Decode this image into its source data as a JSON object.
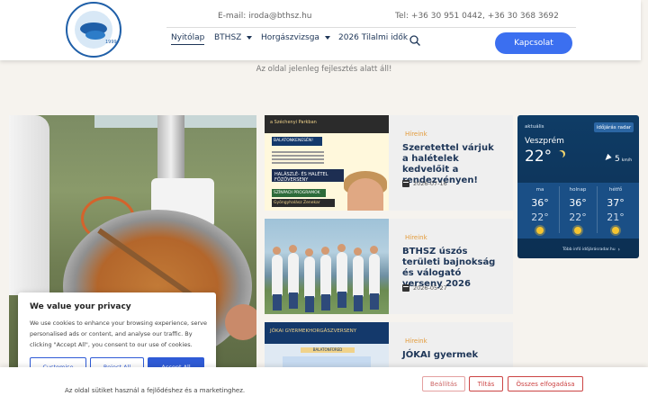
{
  "header": {
    "email": "E-mail: iroda@bthsz.hu",
    "phone": "Tel: +36 30 951 0442, +36 30 368 3692",
    "logo_year": "1999",
    "nav": [
      {
        "label": "Nyitólap"
      },
      {
        "label": "BTHSZ"
      },
      {
        "label": "Horgászvizsga"
      },
      {
        "label": "2026 Tilalmi idők"
      }
    ],
    "login_label": "Kapcsolat"
  },
  "notice": "Az oldal jelenleg fejlesztés alatt áll!",
  "news": [
    {
      "category": "Híreink",
      "title": "Szeretettel várjuk a halételek kedvelőit a rendezvényen!",
      "date": "2026-07-16",
      "thumb_text": {
        "band": "a Széchenyi Parkban",
        "tag": "BALATONKENESÉN!",
        "hal": "HALÁSZLÉ- ÉS HALÉTEL FŐZŐVERSENY",
        "prog": "SZÍNPADI PROGRAMOK",
        "prog2": "Gyöngyhalász Zenekar"
      }
    },
    {
      "category": "Híreink",
      "title": "BTHSZ úszós területi bajnokság és válogató verseny 2026",
      "date": "2026-05-27"
    },
    {
      "category": "Híreink",
      "title": "JÓKAI gyermek",
      "thumb_text": {
        "top": "JÓKAI GYERMEKHORGÁSZVERSENY",
        "sub": "BALATONFÜRED"
      }
    }
  ],
  "weather": {
    "label": "aktuális",
    "link": "időjárás radar",
    "city": "Veszprém",
    "temp": "22°",
    "wind": "5",
    "wind_unit": "km/h",
    "forecast": [
      {
        "day": "ma",
        "hi": "36°",
        "lo": "22°",
        "icon": "sun-icon"
      },
      {
        "day": "holnap",
        "hi": "36°",
        "lo": "22°",
        "icon": "sun-icon"
      },
      {
        "day": "hétfő",
        "hi": "37°",
        "lo": "21°",
        "icon": "sun-icon"
      }
    ],
    "more": "Több infó időjárásradar.hu"
  },
  "cookie": {
    "title": "We value your privacy",
    "text": "We use cookies to enhance your browsing experience, serve personalised ads or content, and analyse our traffic. By clicking \"Accept All\", you consent to our use of cookies.",
    "customise": "Customise",
    "reject": "Reject All",
    "accept": "Accept All"
  },
  "bottom_bar": {
    "text": "Az oldal sütiket használ a fejlődéshez és a marketinghez.",
    "settings": "Beállítás",
    "deny": "Tiltás",
    "accept_all": "Összes elfogadása"
  },
  "colors": {
    "primary_blue": "#3b6ff0",
    "navy": "#1d3557",
    "accent_orange": "#e39b3b",
    "weather_bg": "#0f3c66",
    "cookie_red": "#cc4444"
  }
}
